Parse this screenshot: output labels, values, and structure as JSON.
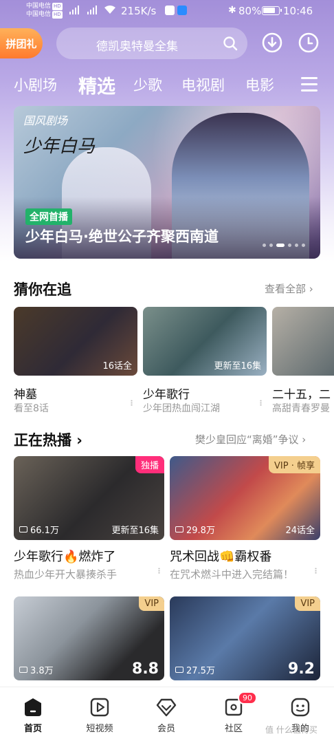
{
  "status": {
    "carrier1": "中国电信",
    "carrier2": "中国电信",
    "hd": "HD",
    "net": "4G",
    "speed": "215K/s",
    "battery": "80%",
    "time": "10:46"
  },
  "header": {
    "promo": "拼团礼",
    "search_placeholder": "德凯奥特曼全集"
  },
  "tabs": [
    {
      "label": "小剧场"
    },
    {
      "label": "精选"
    },
    {
      "label": "少歌"
    },
    {
      "label": "电视剧"
    },
    {
      "label": "电影"
    }
  ],
  "banner": {
    "brand": "国风剧场",
    "logo": "少年白马",
    "badge": "全网首播",
    "title": "少年白马·绝世公子齐聚西南道"
  },
  "follow": {
    "title": "猜你在追",
    "more": "查看全部 ›",
    "items": [
      {
        "name": "神墓",
        "sub": "看至8话",
        "ep": "16话全"
      },
      {
        "name": "少年歌行",
        "sub": "少年团热血闯江湖",
        "ep": "更新至16集"
      },
      {
        "name": "二十五，二",
        "sub": "高甜青春罗曼"
      }
    ]
  },
  "hot": {
    "title": "正在热播 ›",
    "news": "樊少皇回应“离婚”争议 ›",
    "items": [
      {
        "tag": "独播",
        "views": "66.1万",
        "ep": "更新至16集",
        "name": "少年歌行🔥燃炸了",
        "sub": "热血少年开大暴揍杀手"
      },
      {
        "tag": "VIP · 帧享",
        "views": "29.8万",
        "ep": "24话全",
        "name": "咒术回战👊霸权番",
        "sub": "在咒术燃斗中进入完结篇！"
      },
      {
        "tag": "VIP",
        "views": "3.8万",
        "score": "8.8"
      },
      {
        "tag": "VIP",
        "views": "27.5万",
        "score": "9.2"
      }
    ]
  },
  "nav": {
    "items": [
      {
        "label": "首页"
      },
      {
        "label": "短视频"
      },
      {
        "label": "会员"
      },
      {
        "label": "社区",
        "badge": "90"
      },
      {
        "label": "我的"
      }
    ]
  },
  "watermark": "值 什么值得买",
  "colors": {
    "accent": "#9c86d6",
    "pink": "#ff2e7a",
    "vip": "#f4cf8e",
    "green": "#22b26a"
  }
}
